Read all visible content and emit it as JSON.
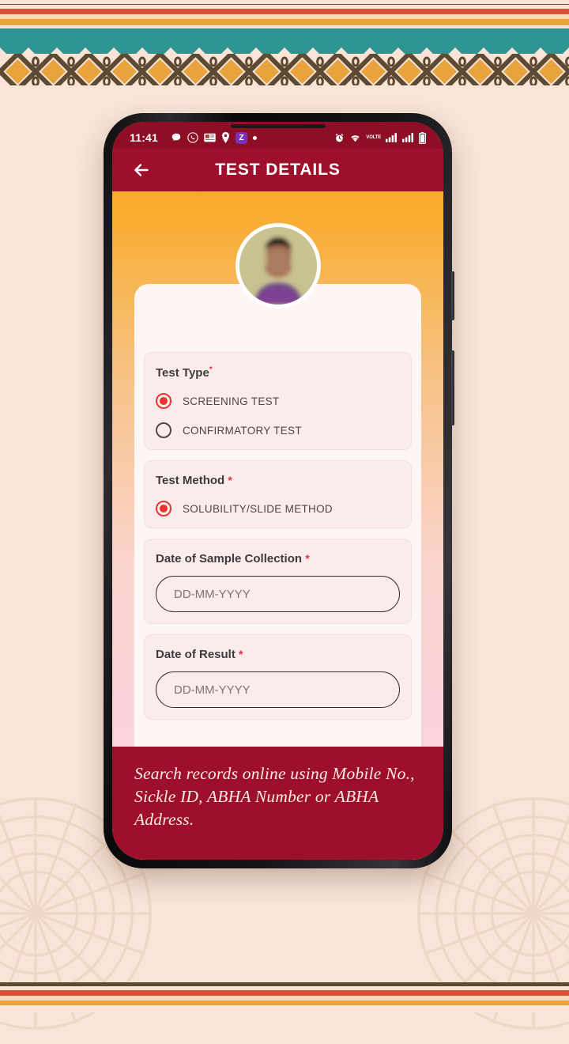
{
  "decor": {
    "top_border_name": "tribal-stripe-zigzag-diamond-border",
    "bottom_border_name": "tribal-stripe-border",
    "background_color": "#F8E5D8",
    "stripe_colors": [
      "#5C4A32",
      "#F7E3D3",
      "#D9503A",
      "#F9D9B8",
      "#E8A33C"
    ],
    "teal_color": "#2E9491",
    "diamond_fill": "#E8A33C",
    "diamond_outline": "#5C4A32"
  },
  "phone": {
    "statusbar": {
      "time": "11:41",
      "left_icons": [
        "chat-bubble-icon",
        "whatsapp-icon",
        "news-card-icon",
        "location-pin-icon",
        "zomato-z-icon",
        "more-dot-icon"
      ],
      "z_badge_label": "Z",
      "right_icons": [
        "alarm-clock-icon",
        "wifi-icon",
        "volte-icon",
        "signal-bars-sim1-icon",
        "signal-bars-sim2-icon",
        "battery-icon"
      ],
      "volte_line1": "VO",
      "volte_line2": "LTE",
      "background_color": "#8E0E26"
    },
    "appbar": {
      "back_label": "back-arrow",
      "title": "TEST DETAILS",
      "background_color": "#9E0F2B"
    },
    "avatar": {
      "name": "patient-avatar",
      "description": "blurred portrait photo"
    },
    "form": {
      "fields": [
        {
          "id": "test-type",
          "label": "Test Type",
          "required": true,
          "required_mark": "*",
          "type": "radio-group",
          "options": [
            {
              "label": "SCREENING TEST",
              "checked": true
            },
            {
              "label": "CONFIRMATORY TEST",
              "checked": false
            }
          ]
        },
        {
          "id": "test-method",
          "label": "Test Method",
          "required": true,
          "required_mark": "*",
          "type": "radio-group",
          "options": [
            {
              "label": "SOLUBILITY/SLIDE METHOD",
              "checked": true
            }
          ]
        },
        {
          "id": "date-of-sample-collection",
          "label": "Date of Sample Collection",
          "required": true,
          "required_mark": "*",
          "type": "date",
          "value": "",
          "placeholder": "DD-MM-YYYY"
        },
        {
          "id": "date-of-result",
          "label": "Date of Result",
          "required": true,
          "required_mark": "*",
          "type": "date",
          "value": "",
          "placeholder": "DD-MM-YYYY"
        }
      ],
      "accent_selected_color": "#E8352C",
      "card_background": "#FBEBEC"
    },
    "caption": {
      "text": "Search records online using Mobile No., Sickle ID, ABHA Number or ABHA Address.",
      "background_color": "#9E0F2B",
      "text_color": "#FDEDE6"
    }
  }
}
